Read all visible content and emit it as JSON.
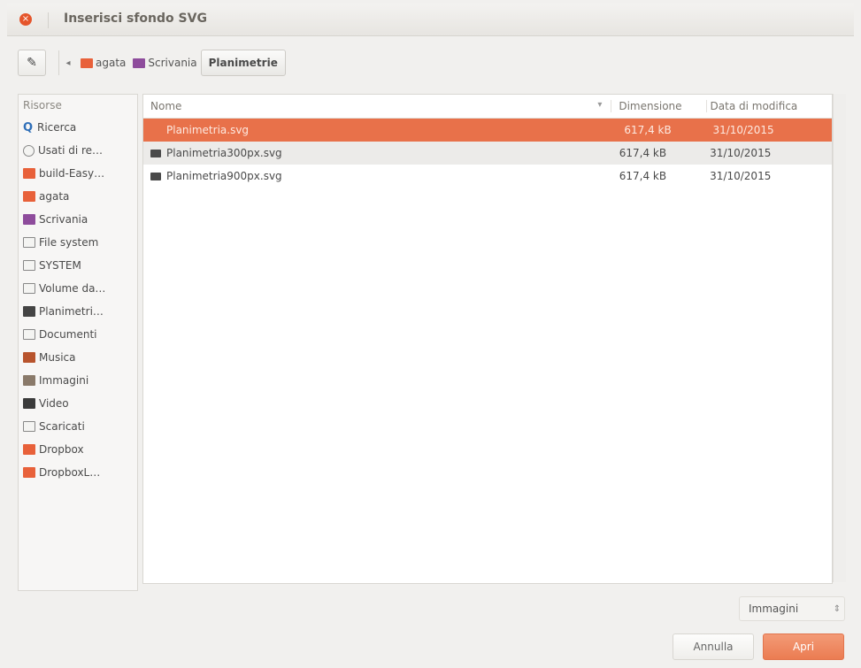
{
  "window": {
    "title": "Inserisci sfondo SVG",
    "close_glyph": "×"
  },
  "pathbar": {
    "edit_glyph": "✎",
    "back_glyph": "◂",
    "crumbs": [
      {
        "label": "agata",
        "color": "#e8613a"
      },
      {
        "label": "Scrivania",
        "color": "#8e4c9c"
      },
      {
        "label": "Planimetrie"
      }
    ]
  },
  "places": {
    "header": "Risorse",
    "items": [
      {
        "label": "Ricerca",
        "icon": "search-icon"
      },
      {
        "label": "Usati di re…",
        "icon": "clock-icon"
      },
      {
        "label": "build-Easy…",
        "icon": "folder-icon",
        "color": "#e8613a"
      },
      {
        "label": "agata",
        "icon": "home-folder-icon",
        "color": "#e8613a"
      },
      {
        "label": "Scrivania",
        "icon": "desktop-folder-icon",
        "color": "#8e4c9c"
      },
      {
        "label": "File system",
        "icon": "drive-icon"
      },
      {
        "label": "SYSTEM",
        "icon": "drive-icon"
      },
      {
        "label": "Volume da…",
        "icon": "drive-icon"
      },
      {
        "label": "Planimetri…",
        "icon": "folder-dark-icon",
        "color": "#444444"
      },
      {
        "label": "Documenti",
        "icon": "documents-icon"
      },
      {
        "label": "Musica",
        "icon": "music-icon",
        "color": "#b8542d"
      },
      {
        "label": "Immagini",
        "icon": "pictures-icon",
        "color": "#8a7a6a"
      },
      {
        "label": "Video",
        "icon": "video-icon",
        "color": "#3b3b3b"
      },
      {
        "label": "Scaricati",
        "icon": "downloads-icon"
      },
      {
        "label": "Dropbox",
        "icon": "folder-icon",
        "color": "#e8613a"
      },
      {
        "label": "DropboxL…",
        "icon": "folder-icon",
        "color": "#e8613a"
      }
    ]
  },
  "files": {
    "columns": {
      "name": "Nome",
      "size": "Dimensione",
      "date": "Data di modifica",
      "sort_glyph": "▾"
    },
    "rows": [
      {
        "name": "Planimetria.svg",
        "size": "617,4 kB",
        "date": "31/10/2015",
        "selected": true
      },
      {
        "name": "Planimetria300px.svg",
        "size": "617,4 kB",
        "date": "31/10/2015"
      },
      {
        "name": "Planimetria900px.svg",
        "size": "617,4 kB",
        "date": "31/10/2015"
      }
    ]
  },
  "filter": {
    "label": "Immagini",
    "arrow_glyph": "⇕"
  },
  "actions": {
    "cancel": "Annulla",
    "open": "Apri"
  },
  "colors": {
    "accent": "#e8714a",
    "selection": "#e8714a"
  }
}
